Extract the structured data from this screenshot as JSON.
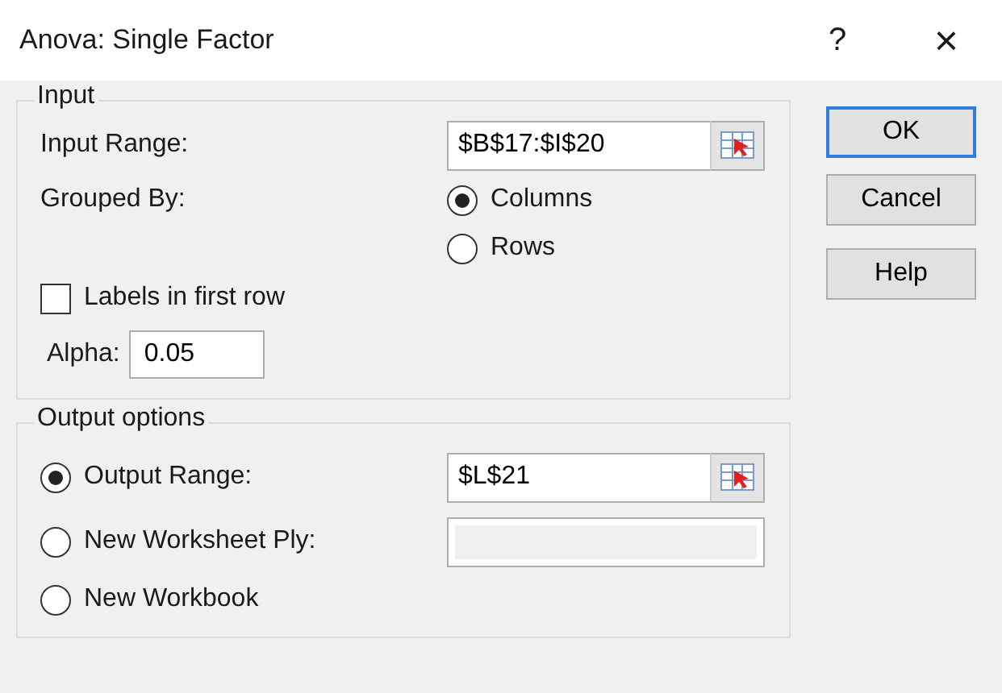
{
  "window": {
    "title": "Anova: Single Factor",
    "help": "?",
    "close": "×"
  },
  "input_group": {
    "legend": "Input",
    "input_range": {
      "label": "Input Range:",
      "value": "$B$17:$I$20"
    },
    "grouped_by": {
      "label": "Grouped By:",
      "options": [
        {
          "label": "Columns",
          "selected": true
        },
        {
          "label": "Rows",
          "selected": false
        }
      ]
    },
    "labels_checkbox": {
      "label": "Labels in first row",
      "checked": false
    },
    "alpha": {
      "label": "Alpha:",
      "value": "0.05"
    }
  },
  "output_group": {
    "legend": "Output options",
    "options": [
      {
        "label": "Output Range:",
        "selected": true,
        "field": {
          "value": "$L$21",
          "disabled": false
        }
      },
      {
        "label": "New Worksheet Ply:",
        "selected": false,
        "field": {
          "disabled": true
        }
      },
      {
        "label": "New Workbook",
        "selected": false
      }
    ]
  },
  "buttons": [
    {
      "label": "OK",
      "default": true
    },
    {
      "label": "Cancel",
      "default": false
    },
    {
      "label": "Help",
      "default": false
    }
  ]
}
